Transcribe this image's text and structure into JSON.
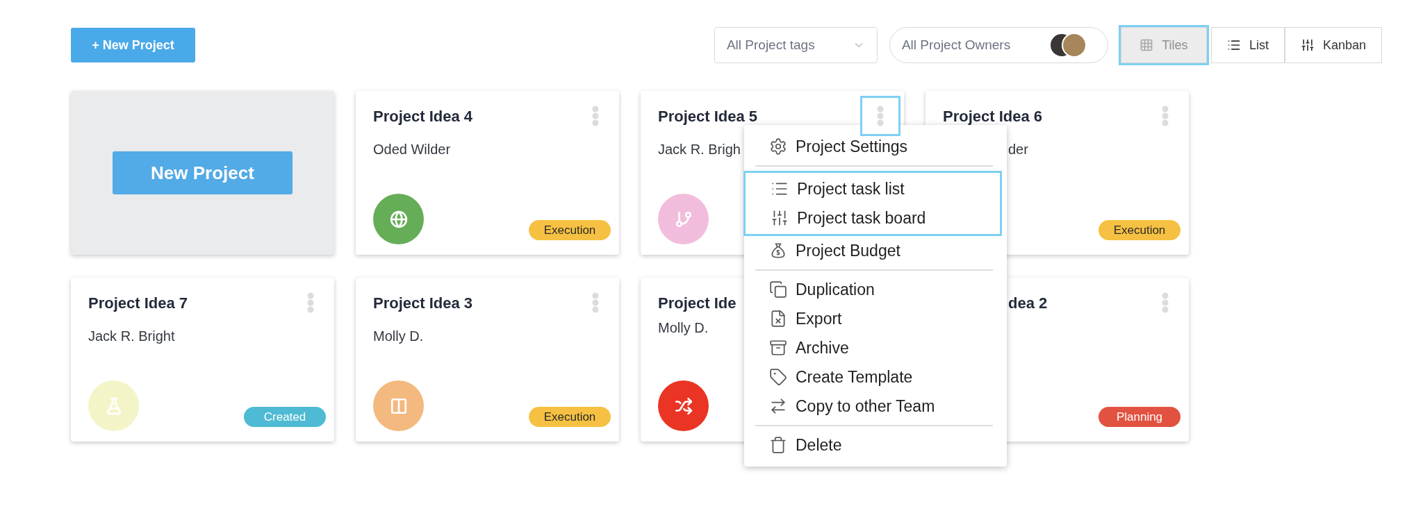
{
  "toolbar": {
    "new_project_button": "+ New Project",
    "tags_filter": {
      "value": "All Project tags"
    },
    "owners_filter": {
      "value": "All Project Owners"
    },
    "views": [
      {
        "label": "Tiles",
        "kind": "grid",
        "selected": true
      },
      {
        "label": "List",
        "kind": "list",
        "selected": false
      },
      {
        "label": "Kanban",
        "kind": "sliders",
        "selected": false
      }
    ]
  },
  "new_project_card": {
    "button": "New Project"
  },
  "projects": [
    {
      "title": "Project Idea 4",
      "owner": "Oded Wilder",
      "icon": {
        "kind": "globe",
        "color": "#66ad57"
      },
      "tag": {
        "label": "Execution",
        "color": "#f6c142"
      },
      "menu_button": {
        "selected": false
      }
    },
    {
      "title": "Project Idea 5",
      "owner": "Jack R. Brigh",
      "icon": {
        "kind": "branch",
        "color": "#f2bddc"
      },
      "menu_button": {
        "selected": true
      }
    },
    {
      "title": "Project Idea 6",
      "owner": "der",
      "tag": {
        "label": "Execution",
        "color": "#f6c142"
      },
      "menu_button": {
        "selected": false
      }
    },
    {
      "title": "Project Idea 7",
      "owner": "Jack R. Bright",
      "icon": {
        "kind": "flask",
        "color": "#f3f5c8"
      },
      "tag": {
        "label": "Created",
        "color": "#4ebad3"
      },
      "menu_button": {
        "selected": false
      }
    },
    {
      "title": "Project Idea 3",
      "owner": "Molly D.",
      "icon": {
        "kind": "columns",
        "color": "#f3b97e"
      },
      "tag": {
        "label": "Execution",
        "color": "#f6c142"
      },
      "menu_button": {
        "selected": false
      }
    },
    {
      "title": "Project Ide",
      "owner": "Molly D.",
      "icon": {
        "kind": "shuffle",
        "color": "#ea3424"
      }
    },
    {
      "title": "dea 2",
      "tag": {
        "label": "Planning",
        "color": "#e15241"
      },
      "menu_button": {
        "selected": false
      }
    }
  ],
  "context_menu": {
    "groups": [
      [
        {
          "label": "Project Settings",
          "kind": "settings",
          "highlighted": false
        }
      ],
      [
        {
          "label": "Project task list",
          "kind": "list",
          "highlighted": true
        },
        {
          "label": "Project task board",
          "kind": "sliders",
          "highlighted": true
        },
        {
          "label": "Project Budget",
          "kind": "bag",
          "highlighted": false
        }
      ],
      [
        {
          "label": "Duplication",
          "kind": "copy",
          "highlighted": false
        },
        {
          "label": "Export",
          "kind": "file-x",
          "highlighted": false
        },
        {
          "label": "Archive",
          "kind": "archive",
          "highlighted": false
        },
        {
          "label": "Create Template",
          "kind": "tag",
          "highlighted": false
        },
        {
          "label": "Copy to other Team",
          "kind": "swap",
          "highlighted": false
        }
      ],
      [
        {
          "label": "Delete",
          "kind": "trash",
          "highlighted": false
        }
      ]
    ]
  }
}
